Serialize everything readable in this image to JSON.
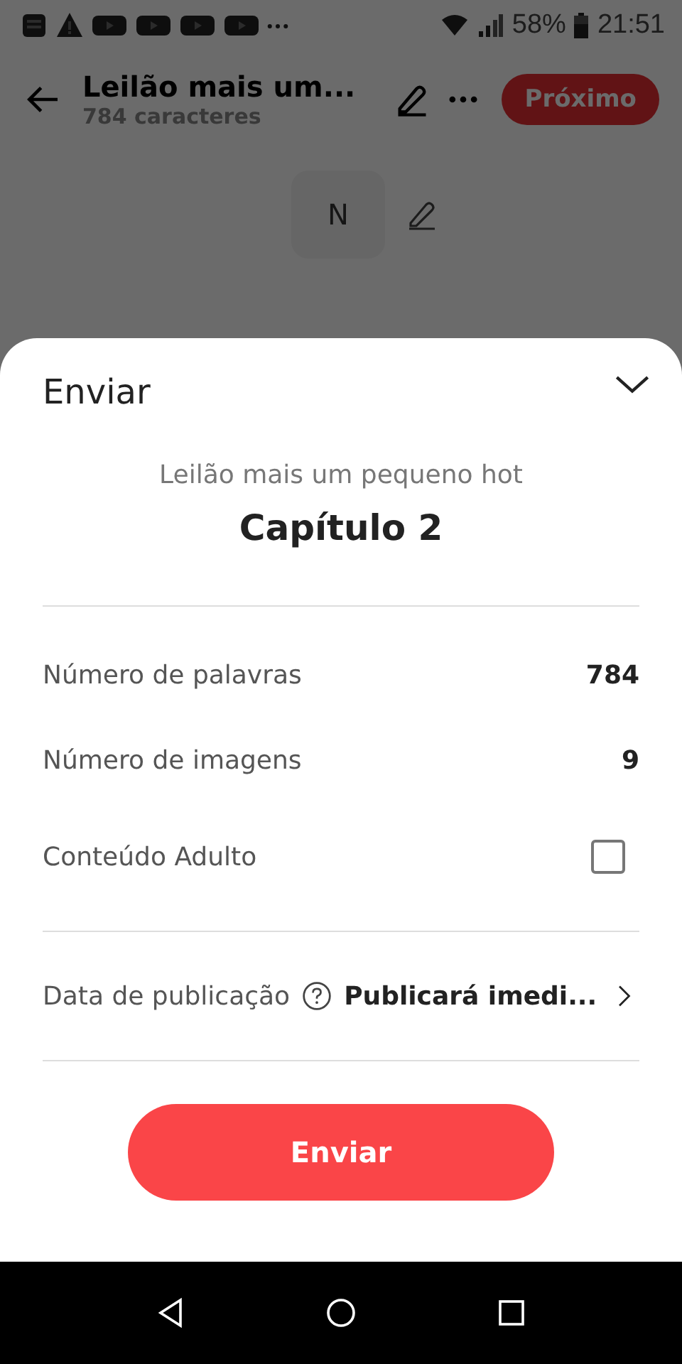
{
  "status_bar": {
    "battery": "58%",
    "time": "21:51"
  },
  "header": {
    "title": "Leilão mais um...",
    "subtitle": "784 caracteres",
    "next_button": "Próximo"
  },
  "blocks": [
    {
      "label": "N"
    }
  ],
  "sheet": {
    "title": "Enviar",
    "story": "Leilão mais um pequeno hot",
    "chapter": "Capítulo 2",
    "rows": [
      {
        "kind": "value",
        "label": "Número de palavras",
        "value": "784"
      },
      {
        "kind": "value",
        "label": "Número de imagens",
        "value": "9"
      },
      {
        "kind": "checkbox",
        "label": "Conteúdo Adulto",
        "checked": false
      }
    ],
    "publish": {
      "label": "Data de publicação",
      "value": "Publicará imedi..."
    },
    "submit_button": "Enviar"
  }
}
